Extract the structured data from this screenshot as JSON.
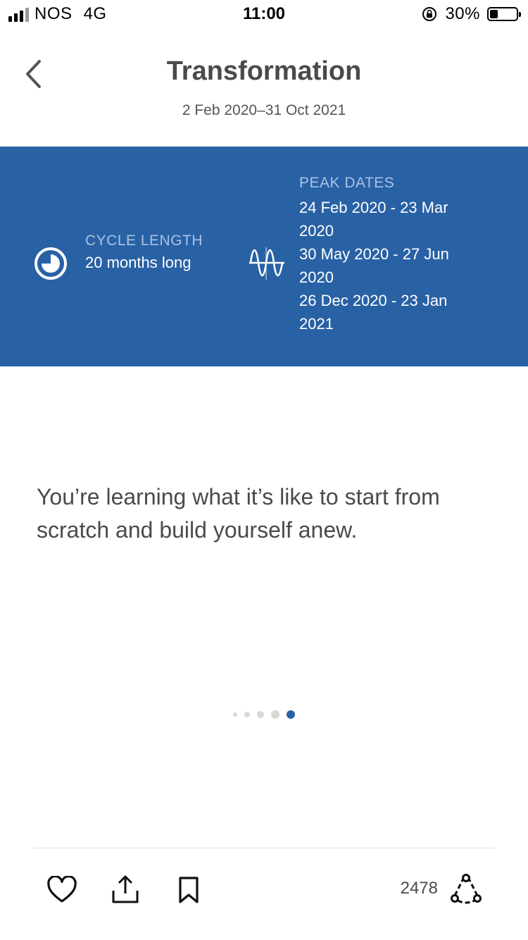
{
  "status_bar": {
    "carrier": "NOS",
    "network": "4G",
    "time": "11:00",
    "battery_percent": "30%",
    "battery_level": 0.3
  },
  "header": {
    "title": "Transformation",
    "date_range": "2 Feb 2020–31 Oct 2021",
    "back_icon": "chevron-left-icon"
  },
  "info_panel": {
    "background_color": "#2961a5",
    "cycle": {
      "icon": "cycle-clock-icon",
      "label": "CYCLE LENGTH",
      "value": "20 months long"
    },
    "peak": {
      "icon": "wave-icon",
      "label": "PEAK DATES",
      "dates": [
        "24 Feb 2020 - 23 Mar 2020",
        "30 May 2020 - 27 Jun 2020",
        "26 Dec 2020 - 23 Jan 2021"
      ]
    }
  },
  "message": "You’re learning what it’s like to start from scratch and build yourself anew.",
  "pagination": {
    "total": 5,
    "active_index": 4,
    "active_color": "#2961a5"
  },
  "toolbar": {
    "like_icon": "heart-icon",
    "share_icon": "share-icon",
    "bookmark_icon": "bookmark-icon",
    "count": "2478",
    "connections_icon": "connections-icon"
  }
}
